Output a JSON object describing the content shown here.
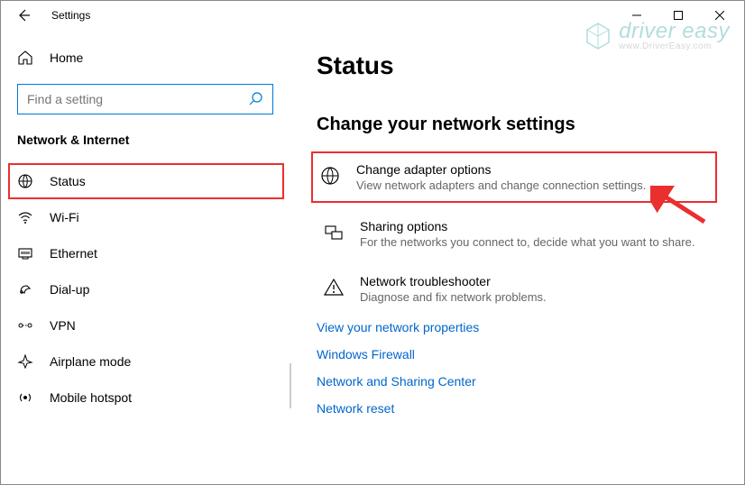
{
  "titlebar": {
    "title": "Settings"
  },
  "sidebar": {
    "home_label": "Home",
    "search_placeholder": "Find a setting",
    "group_header": "Network & Internet",
    "items": [
      {
        "label": "Status"
      },
      {
        "label": "Wi-Fi"
      },
      {
        "label": "Ethernet"
      },
      {
        "label": "Dial-up"
      },
      {
        "label": "VPN"
      },
      {
        "label": "Airplane mode"
      },
      {
        "label": "Mobile hotspot"
      }
    ]
  },
  "main": {
    "page_title": "Status",
    "section_title": "Change your network settings",
    "options": [
      {
        "label": "Change adapter options",
        "desc": "View network adapters and change connection settings."
      },
      {
        "label": "Sharing options",
        "desc": "For the networks you connect to, decide what you want to share."
      },
      {
        "label": "Network troubleshooter",
        "desc": "Diagnose and fix network problems."
      }
    ],
    "links": [
      "View your network properties",
      "Windows Firewall",
      "Network and Sharing Center",
      "Network reset"
    ]
  },
  "watermark": {
    "main": "driver easy",
    "sub": "www.DriverEasy.com"
  }
}
